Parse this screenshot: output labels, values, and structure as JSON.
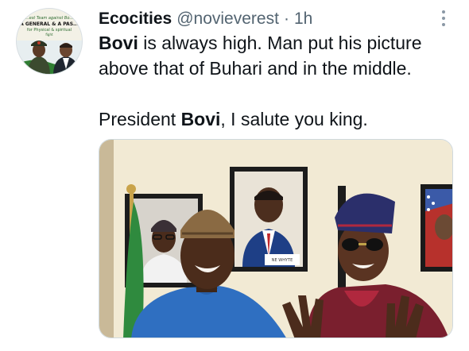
{
  "tweet": {
    "display_name": "Ecocities",
    "handle": "@novieverest",
    "separator": "·",
    "time": "1h",
    "more_icon": "more-vertical-icon",
    "line1": {
      "bold": "Bovi",
      "rest": " is always high. Man put his picture"
    },
    "line2": "above that of Buhari and in the middle.",
    "line3": {
      "before": "President ",
      "bold": "Bovi",
      "after": ", I salute you king."
    }
  },
  "avatar": {
    "line1": "...est Team against Bo...",
    "line2": "A GENERAL & A PAS...",
    "line3": "for Physical & spiritual",
    "line4": "fight"
  },
  "media": {
    "frame_caption": "NE WHYTE"
  },
  "colors": {
    "text": "#0f1419",
    "secondary": "#536471",
    "border": "#cfd9de"
  }
}
